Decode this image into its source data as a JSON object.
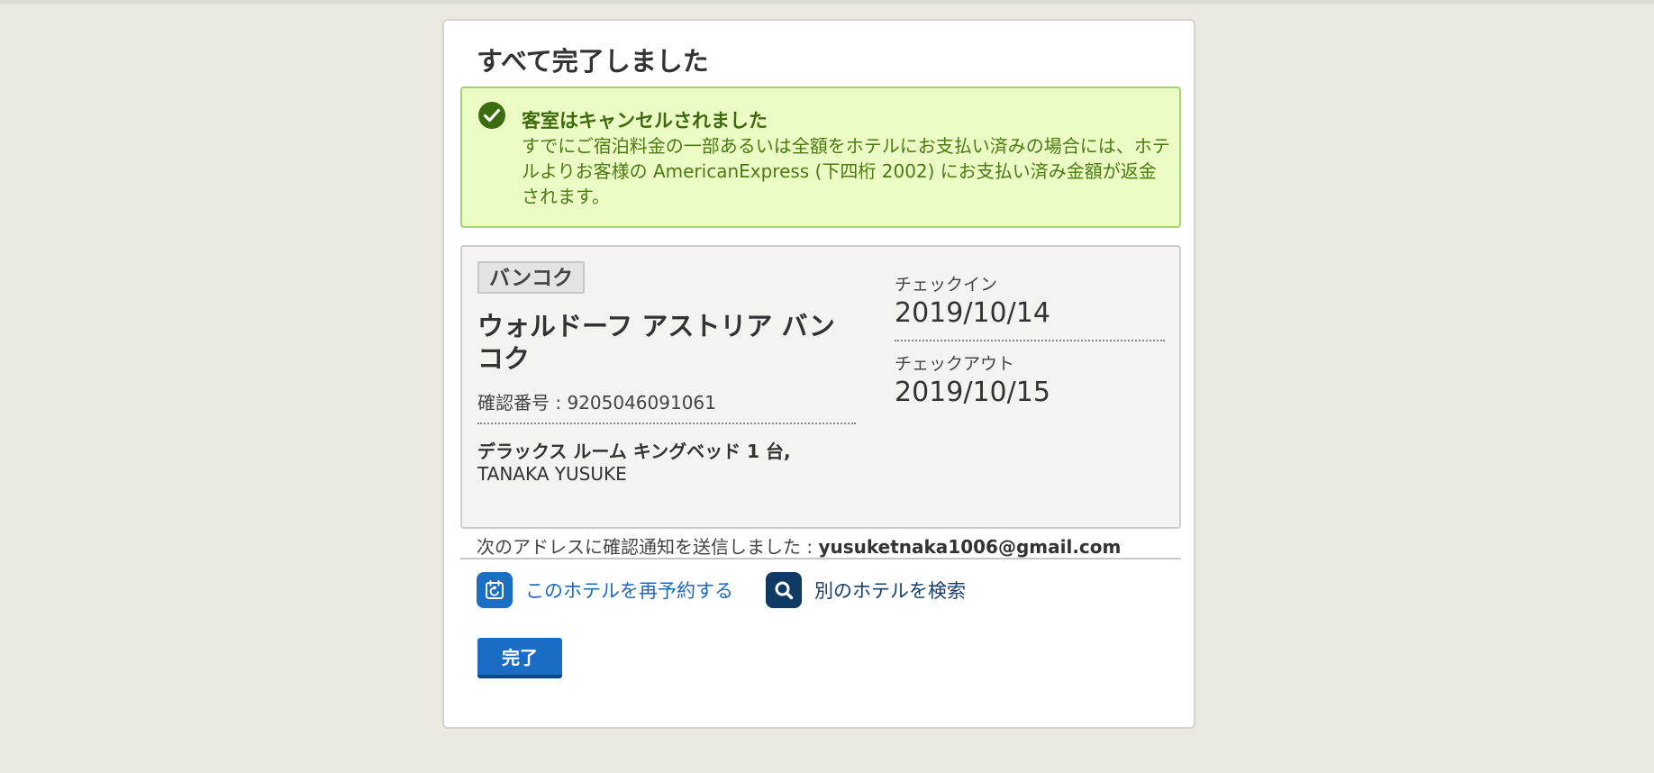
{
  "page": {
    "title": "すべて完了しました"
  },
  "alert": {
    "icon": "check-circle-icon",
    "title": "客室はキャンセルされました",
    "body": "すでにご宿泊料金の一部あるいは全額をホテルにお支払い済みの場合には、ホテルよりお客様の AmericanExpress (下四桁 2002) にお支払い済み金額が返金されます。",
    "colors": {
      "background": "#ebfcc5",
      "border": "#a9d178",
      "text": "#4c7a12",
      "icon": "#3b6d0e"
    }
  },
  "reservation": {
    "city": "バンコク",
    "hotel_name": "ウォルドーフ アストリア バンコク",
    "confirmation": "確認番号 : 9205046091061",
    "room_type": "デラックス ルーム キングベッド 1 台,",
    "guest_name": "TANAKA YUSUKE",
    "checkin_label": "チェックイン",
    "checkin_date": "2019/10/14",
    "checkout_label": "チェックアウト",
    "checkout_date": "2019/10/15"
  },
  "notification": {
    "prefix": "次のアドレスに確認通知を送信しました : ",
    "email": "yusuketnaka1006@gmail.com"
  },
  "actions": {
    "rebook": {
      "icon": "calendar-rebook-icon",
      "label": "このホテルを再予約する"
    },
    "search_other": {
      "icon": "search-icon",
      "label": "別のホテルを検索"
    }
  },
  "done_button": {
    "label": "完了",
    "color": "#1a6cc4"
  }
}
